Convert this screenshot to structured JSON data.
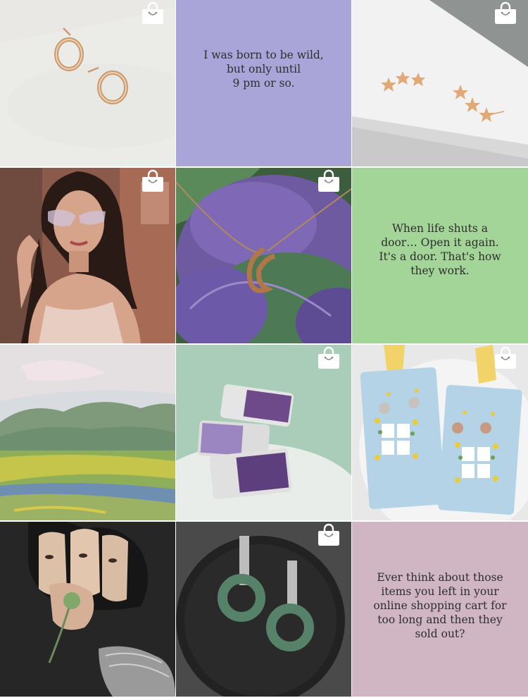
{
  "feed": {
    "tiles": [
      {
        "id": "hoop-earrings",
        "type": "photo",
        "shoppable": true
      },
      {
        "id": "quote-wild",
        "type": "quote",
        "text": "I was born to be wild,\nbut only until\n9 pm or so.",
        "bg": "#aaa5d9"
      },
      {
        "id": "star-earrings",
        "type": "photo",
        "shoppable": true
      },
      {
        "id": "model-portrait",
        "type": "photo",
        "shoppable": true
      },
      {
        "id": "cabbage-necklace",
        "type": "photo",
        "shoppable": true
      },
      {
        "id": "quote-door",
        "type": "quote",
        "text": "When life shuts a\ndoor… Open it again.\nIt's a door. That's how\nthey work.",
        "bg": "#a4d598"
      },
      {
        "id": "monet-field",
        "type": "photo",
        "shoppable": false
      },
      {
        "id": "amethyst-rings",
        "type": "photo",
        "shoppable": true
      },
      {
        "id": "lemons-earrings",
        "type": "photo",
        "shoppable": true
      },
      {
        "id": "surreal-collage",
        "type": "photo",
        "shoppable": false
      },
      {
        "id": "jade-earrings",
        "type": "photo",
        "shoppable": true
      },
      {
        "id": "quote-cart",
        "type": "quote",
        "text": "Ever think about those\nitems you left in your\nonline shopping cart for\ntoo long and then they\nsold out?",
        "bg": "#d0b6c2"
      }
    ]
  },
  "icons": {
    "shop": "shopping-bag-icon"
  },
  "colors": {
    "icon_fill": "#ffffff",
    "quote_text": "#2e2e2e"
  }
}
